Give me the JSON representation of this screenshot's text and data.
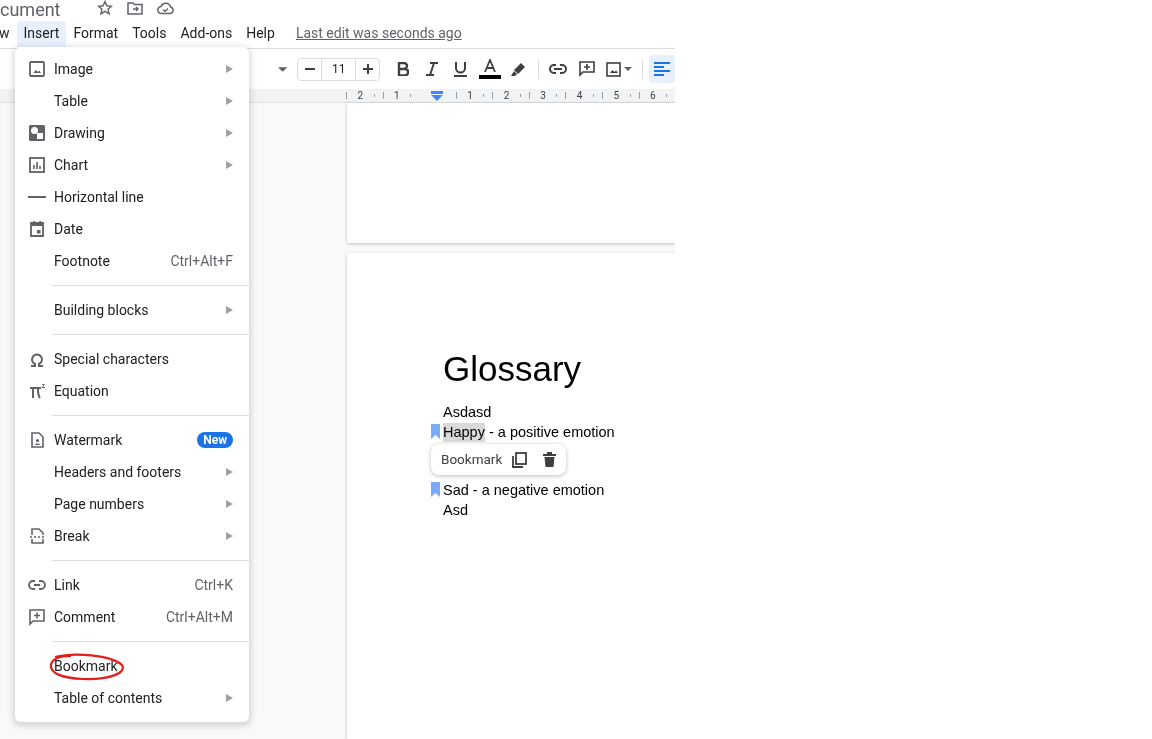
{
  "doc_title": "cument",
  "menu_bar": {
    "items": [
      {
        "label": "w",
        "selected": false
      },
      {
        "label": "Insert",
        "selected": true
      },
      {
        "label": "Format",
        "selected": false
      },
      {
        "label": "Tools",
        "selected": false
      },
      {
        "label": "Add-ons",
        "selected": false
      },
      {
        "label": "Help",
        "selected": false
      }
    ],
    "last_edit": "Last edit was seconds ago"
  },
  "toolbar": {
    "font_size": "11",
    "align_left_selected": true
  },
  "ruler": [
    "2",
    "1",
    "1",
    "2",
    "3",
    "4",
    "5",
    "6"
  ],
  "insert_menu": [
    [
      {
        "label": "Image",
        "submenu": true,
        "circled": false
      },
      {
        "label": "Table",
        "submenu": true,
        "circled": false
      },
      {
        "label": "Drawing",
        "submenu": true,
        "circled": false
      },
      {
        "label": "Chart",
        "submenu": true,
        "circled": false
      },
      {
        "label": "Horizontal line",
        "submenu": false,
        "circled": false
      },
      {
        "label": "Date",
        "submenu": false,
        "circled": false
      },
      {
        "label": "Footnote",
        "shortcut": "Ctrl+Alt+F",
        "submenu": false,
        "circled": false
      }
    ],
    [
      {
        "label": "Building blocks",
        "submenu": true,
        "circled": false
      }
    ],
    [
      {
        "label": "Special characters",
        "submenu": false,
        "circled": false
      },
      {
        "label": "Equation",
        "submenu": false,
        "circled": false
      }
    ],
    [
      {
        "label": "Watermark",
        "badge": "New",
        "submenu": false,
        "circled": false
      },
      {
        "label": "Headers and footers",
        "submenu": true,
        "circled": false
      },
      {
        "label": "Page numbers",
        "submenu": true,
        "circled": false
      },
      {
        "label": "Break",
        "submenu": true,
        "circled": false
      }
    ],
    [
      {
        "label": "Link",
        "shortcut": "Ctrl+K",
        "submenu": false,
        "circled": false
      },
      {
        "label": "Comment",
        "shortcut": "Ctrl+Alt+M",
        "submenu": false,
        "circled": false
      }
    ],
    [
      {
        "label": "Bookmark",
        "submenu": false,
        "circled": true
      },
      {
        "label": "Table of contents",
        "submenu": true,
        "circled": false
      }
    ]
  ],
  "document": {
    "heading": "Glossary",
    "lines": [
      {
        "segments": [
          {
            "text": "Asdasd",
            "selected": false
          }
        ],
        "bookmarked": false
      },
      {
        "segments": [
          {
            "text": "Happy",
            "selected": true
          },
          {
            "text": " - a positive emotion",
            "selected": false
          }
        ],
        "bookmarked": true
      },
      {
        "kind": "hidden"
      },
      {
        "segments": [
          {
            "text": "Sad - a negative emotion",
            "selected": false
          }
        ],
        "bookmarked": true
      },
      {
        "segments": [
          {
            "text": "Asd",
            "selected": false
          }
        ],
        "bookmarked": false
      }
    ],
    "bookmark_popup": {
      "label": "Bookmark"
    }
  }
}
